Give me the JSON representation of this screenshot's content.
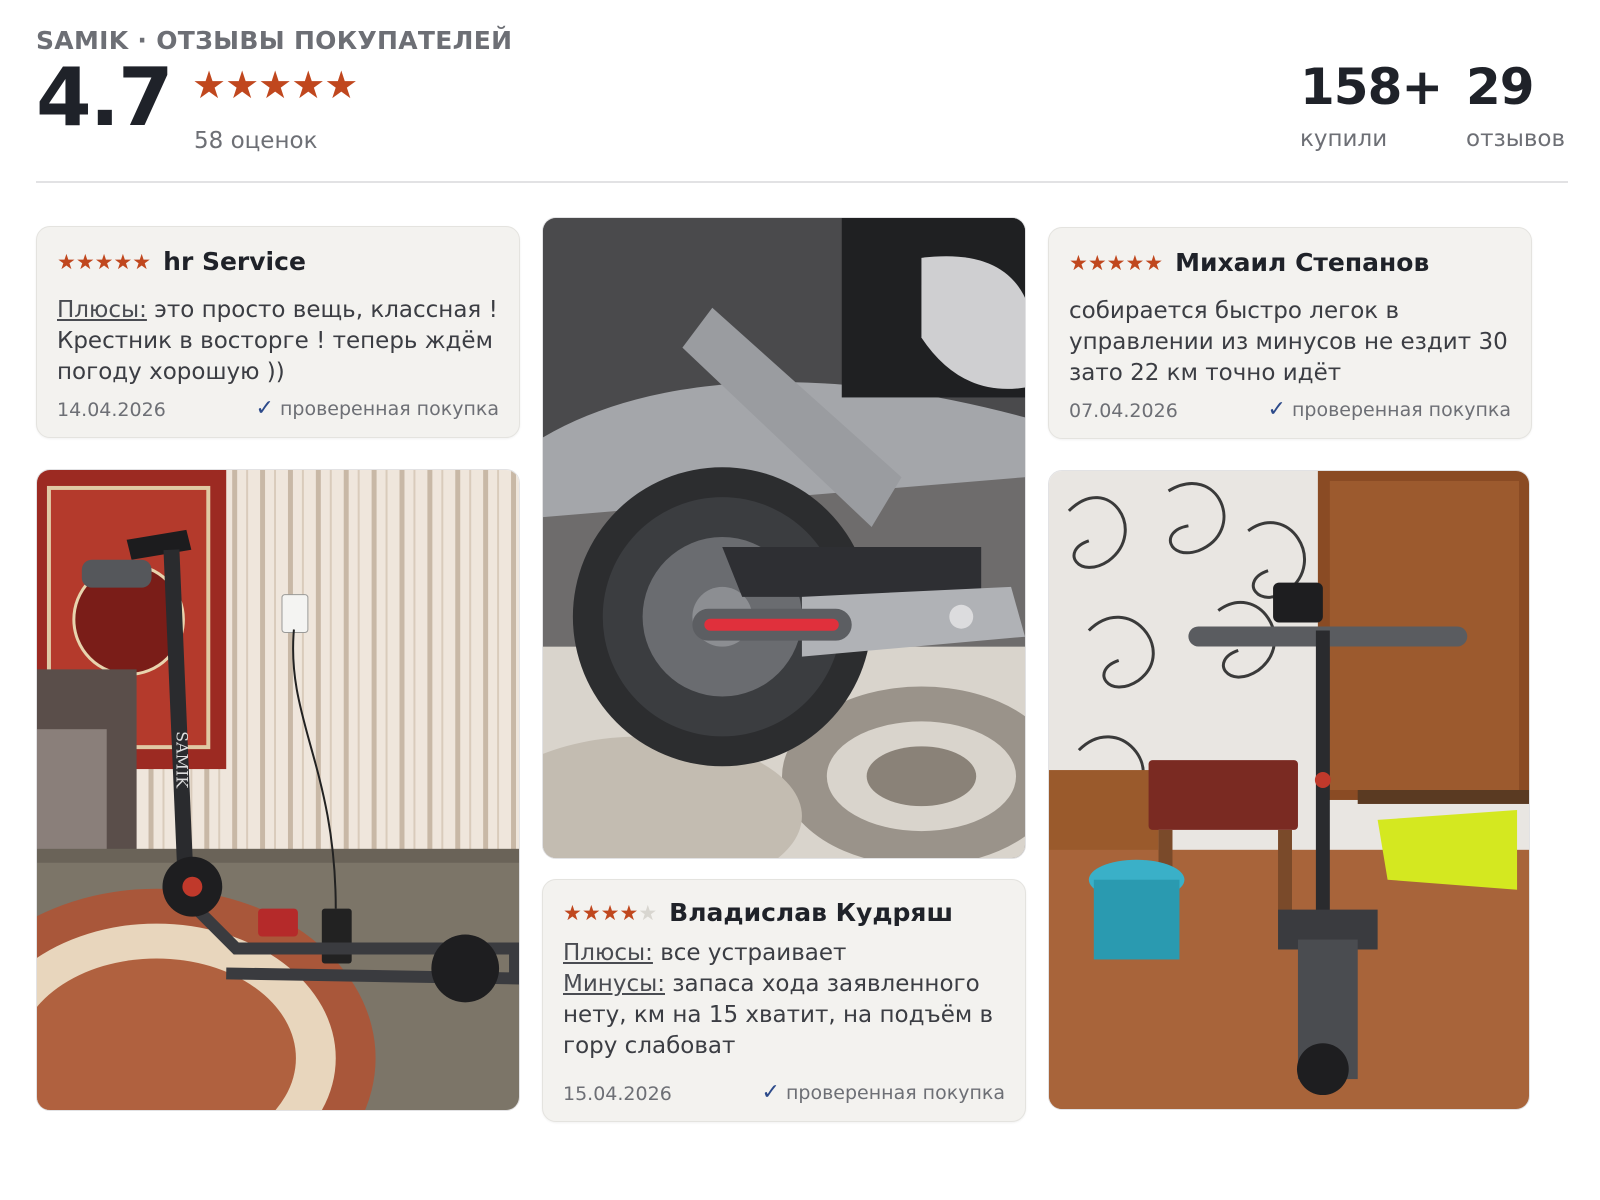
{
  "header": {
    "brand": "SAMIK · ОТЗЫВЫ ПОКУПАТЕЛЕЙ",
    "rating": "4.7",
    "stars": "★★★★★",
    "ratings_count": "58 оценок",
    "bought_value": "158+",
    "bought_label": "купили",
    "reviews_value": "29",
    "reviews_label": "отзывов"
  },
  "reviews": [
    {
      "stars_on": "★★★★★",
      "stars_off": "",
      "rating": 5,
      "author": "hr Service",
      "pros_label": "Плюсы:",
      "pros": " это просто вещь, классная ! Крестник в восторге ! теперь ждём погоду хорошую ))",
      "date": "14.04.2026",
      "verified": "проверенная покупка"
    },
    {
      "stars_on": "★★★★★",
      "stars_off": "",
      "rating": 5,
      "author": "Михаил Степанов",
      "text": "собирается быстро легок в управлении из минусов не ездит 30 зато 22 км точно идёт",
      "date": "07.04.2026",
      "verified": "проверенная покупка"
    },
    {
      "stars_on": "★★★★",
      "stars_off": "★",
      "rating": 4,
      "author": "Владислав Кудряш",
      "pros_label": "Плюсы:",
      "pros": " все устраивает",
      "cons_label": "Минусы:",
      "cons": " запаса хода заявленного нету, км на 15 хватит, на подъём в гору слабоват",
      "date": "15.04.2026",
      "verified": "проверенная покупка"
    }
  ],
  "photo_text": "SAMIK",
  "check_glyph": "✓",
  "colors": {
    "star": "#c0471e",
    "card_bg": "#f3f2ef",
    "verified_check": "#2c4a8a",
    "rear_light": "#e0303c"
  }
}
